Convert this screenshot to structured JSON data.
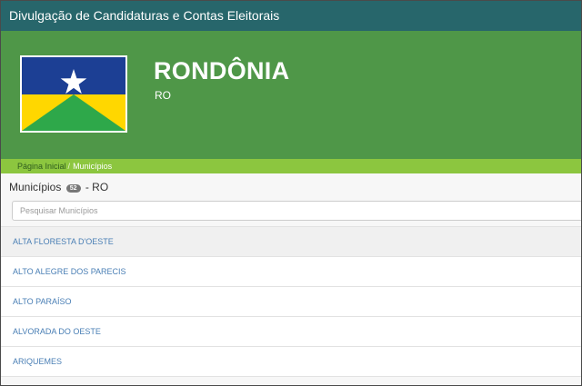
{
  "header": {
    "title": "Divulgação de Candidaturas e Contas Eleitorais"
  },
  "state": {
    "name": "RONDÔNIA",
    "code": "RO",
    "flag_colors": {
      "blue": "#1c3f94",
      "yellow": "#ffd700",
      "green": "#2ea84a",
      "star": "#ffffff"
    }
  },
  "breadcrumb": {
    "home": "Página Inicial",
    "separator": "/",
    "current": "Municípios"
  },
  "list": {
    "label": "Municípios",
    "count": "52",
    "suffix": "- RO",
    "search_placeholder": "Pesquisar Municípios",
    "items": [
      "ALTA FLORESTA D'OESTE",
      "ALTO ALEGRE DOS PARECIS",
      "ALTO PARAÍSO",
      "ALVORADA DO OESTE",
      "ARIQUEMES"
    ]
  },
  "colors": {
    "topbar": "#27666b",
    "hero": "#4f9748",
    "breadcrumb_bar": "#8cc63f",
    "link": "#4a7fb5"
  }
}
